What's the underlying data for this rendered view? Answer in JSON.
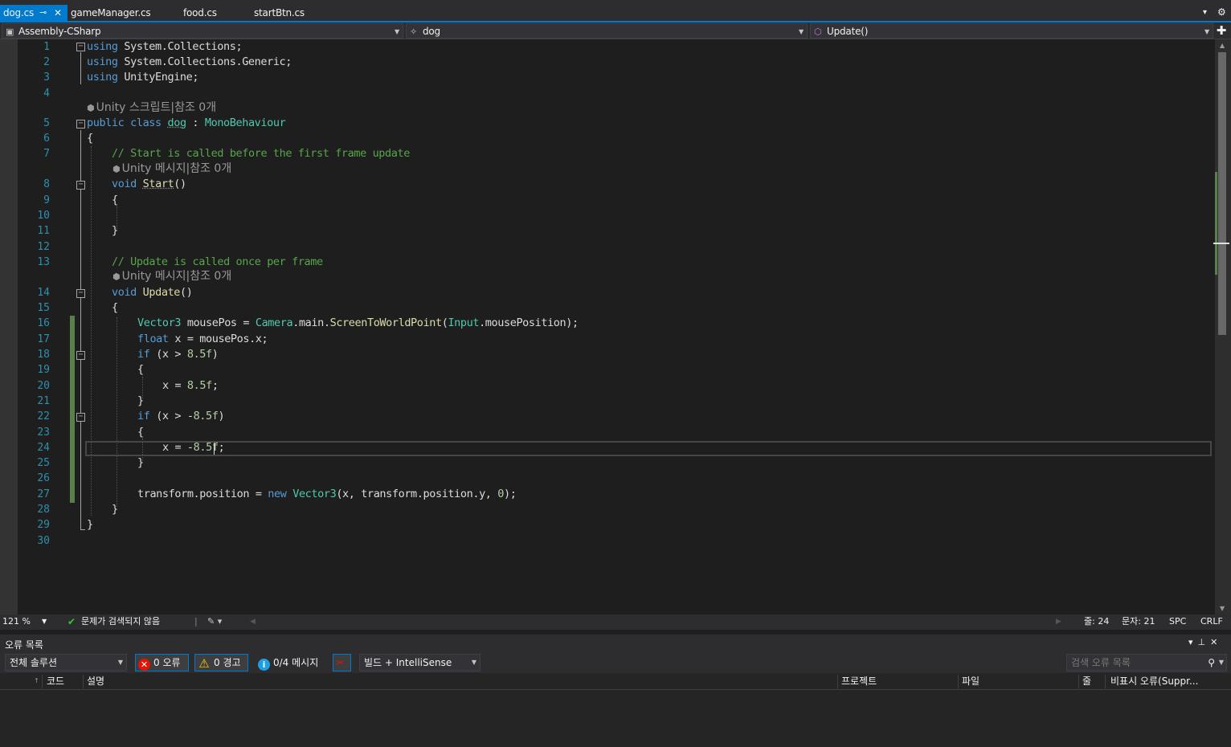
{
  "tabs": [
    {
      "label": "dog.cs",
      "active": true
    },
    {
      "label": "gameManager.cs"
    },
    {
      "label": "food.cs"
    },
    {
      "label": "startBtn.cs"
    }
  ],
  "tab_icons": {
    "pin": "⊸",
    "close": "✕",
    "overflow": "▾",
    "gear": "⚙"
  },
  "navbar": {
    "project": "Assembly-CSharp",
    "class": "dog",
    "member": "Update()"
  },
  "codelens": {
    "script": "Unity 스크립트|참조 0개",
    "message": "Unity 메시지|참조 0개"
  },
  "code": {
    "l1": {
      "n": "1",
      "kw": "using",
      "rest": " System.Collections;"
    },
    "l2": {
      "n": "2",
      "kw": "using",
      "rest": " System.Collections.Generic;"
    },
    "l3": {
      "n": "3",
      "kw": "using",
      "rest": " UnityEngine;"
    },
    "l4": {
      "n": "4"
    },
    "l5": {
      "n": "5",
      "kw1": "public",
      "kw2": "class",
      "name": "dog",
      "colon": " : ",
      "base": "MonoBehaviour"
    },
    "l6": {
      "n": "6",
      "text": "{"
    },
    "l7": {
      "n": "7",
      "comment": "// Start is called before the first frame update"
    },
    "l8": {
      "n": "8",
      "kw": "void",
      "fn": "Start",
      "rest": "()"
    },
    "l9": {
      "n": "9",
      "text": "{"
    },
    "l10": {
      "n": "10"
    },
    "l11": {
      "n": "11",
      "text": "}"
    },
    "l12": {
      "n": "12"
    },
    "l13": {
      "n": "13",
      "comment": "// Update is called once per frame"
    },
    "l14": {
      "n": "14",
      "kw": "void",
      "fn": "Update",
      "rest": "()"
    },
    "l15": {
      "n": "15",
      "text": "{"
    },
    "l16": {
      "n": "16",
      "t1": "Vector3",
      "a": " mousePos = ",
      "t2": "Camera",
      "b": ".main.",
      "fn": "ScreenToWorldPoint",
      "c": "(",
      "t3": "Input",
      "d": ".mousePosition);"
    },
    "l17": {
      "n": "17",
      "kw": "float",
      "rest": " x = mousePos.x;"
    },
    "l18": {
      "n": "18",
      "kw": "if",
      "a": " (x > ",
      "num": "8.5f",
      "b": ")"
    },
    "l19": {
      "n": "19",
      "text": "{"
    },
    "l20": {
      "n": "20",
      "a": "x = ",
      "num": "8.5f",
      "b": ";"
    },
    "l21": {
      "n": "21",
      "text": "}"
    },
    "l22": {
      "n": "22",
      "kw": "if",
      "a": " (x > -",
      "num": "8.5f",
      "b": ")"
    },
    "l23": {
      "n": "23",
      "text": "{"
    },
    "l24": {
      "n": "24",
      "a": "x = -",
      "num": "8.5f",
      "b": ";"
    },
    "l25": {
      "n": "25",
      "text": "}"
    },
    "l26": {
      "n": "26"
    },
    "l27": {
      "n": "27",
      "a": "transform.position = ",
      "kw": "new",
      "sp": " ",
      "t1": "Vector3",
      "b": "(x, transform.position.y, ",
      "num": "0",
      "c": ");"
    },
    "l28": {
      "n": "28",
      "text": "}"
    },
    "l29": {
      "n": "29",
      "text": "}"
    },
    "l30": {
      "n": "30"
    }
  },
  "statusbar": {
    "zoom": "121 %",
    "issues": "문제가 검색되지 않음",
    "line": "줄: 24",
    "col": "문자: 21",
    "spc": "SPC",
    "eol": "CRLF"
  },
  "error_list": {
    "title": "오류 목록",
    "scope": "전체 솔루션",
    "errors": "0 오류",
    "warnings": "0 경고",
    "messages": "0/4 메시지",
    "build_filter": "빌드 + IntelliSense",
    "search_placeholder": "검색 오류 목록",
    "columns": [
      "코드",
      "설명",
      "프로젝트",
      "파일",
      "줄",
      "비표시 오류(Suppr..."
    ]
  },
  "colors": {
    "accent": "#007acc",
    "keyword": "#569cd6",
    "type": "#4ec9b0",
    "comment": "#57a64a",
    "number": "#b5cea8",
    "method": "#dcdcaa",
    "changed": "#57804a"
  }
}
